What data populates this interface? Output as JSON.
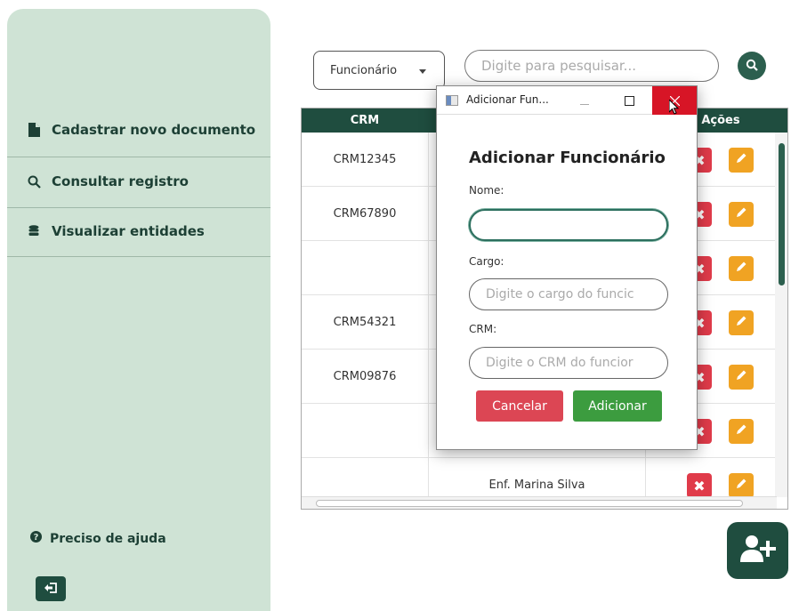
{
  "sidebar": {
    "items": [
      {
        "label": "Cadastrar novo documento",
        "icon": "file-icon"
      },
      {
        "label": "Consultar registro",
        "icon": "search-icon"
      },
      {
        "label": "Visualizar entidades",
        "icon": "database-icon"
      }
    ],
    "help_label": "Preciso de ajuda",
    "help_icon": "question-circle-icon",
    "logout_icon": "sign-out-icon"
  },
  "toolbar": {
    "filter_value": "Funcionário",
    "search_placeholder": "Digite para pesquisar...",
    "search_icon": "search-icon"
  },
  "table": {
    "headers": [
      "CRM",
      "Ações"
    ],
    "rows": [
      {
        "crm": "CRM12345",
        "name": ""
      },
      {
        "crm": "CRM67890",
        "name": ""
      },
      {
        "crm": "",
        "name": ""
      },
      {
        "crm": "CRM54321",
        "name": ""
      },
      {
        "crm": "CRM09876",
        "name": ""
      },
      {
        "crm": "",
        "name": ""
      },
      {
        "crm": "",
        "name": "Enf. Marina Silva"
      }
    ]
  },
  "fab_icon": "add-user-icon",
  "dialog": {
    "window_title": "Adicionar Fun...",
    "heading": "Adicionar Funcionário",
    "name_label": "Nome:",
    "name_value": "",
    "role_label": "Cargo:",
    "role_placeholder": "Digite o cargo do funcic",
    "crm_label": "CRM:",
    "crm_placeholder": "Digite o CRM do funcior",
    "cancel_label": "Cancelar",
    "add_label": "Adicionar"
  },
  "colors": {
    "primary": "#1f4d3f",
    "sidebar_bg": "#cfe3d5",
    "danger": "#e03b4a",
    "warning": "#f0a323",
    "success": "#3c9c3f"
  }
}
